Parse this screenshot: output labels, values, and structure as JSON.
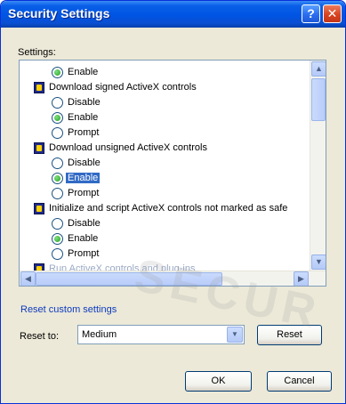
{
  "window": {
    "title": "Security Settings",
    "help_button": "?",
    "close_button": "✕"
  },
  "settings_label": "Settings:",
  "items": [
    {
      "kind": "radio",
      "label": "Enable",
      "checked": true,
      "selected": false
    },
    {
      "kind": "group",
      "label": "Download signed ActiveX controls"
    },
    {
      "kind": "radio",
      "label": "Disable",
      "checked": false,
      "selected": false
    },
    {
      "kind": "radio",
      "label": "Enable",
      "checked": true,
      "selected": false
    },
    {
      "kind": "radio",
      "label": "Prompt",
      "checked": false,
      "selected": false
    },
    {
      "kind": "group",
      "label": "Download unsigned ActiveX controls"
    },
    {
      "kind": "radio",
      "label": "Disable",
      "checked": false,
      "selected": false
    },
    {
      "kind": "radio",
      "label": "Enable",
      "checked": true,
      "selected": true
    },
    {
      "kind": "radio",
      "label": "Prompt",
      "checked": false,
      "selected": false
    },
    {
      "kind": "group",
      "label": "Initialize and script ActiveX controls not marked as safe"
    },
    {
      "kind": "radio",
      "label": "Disable",
      "checked": false,
      "selected": false
    },
    {
      "kind": "radio",
      "label": "Enable",
      "checked": true,
      "selected": false
    },
    {
      "kind": "radio",
      "label": "Prompt",
      "checked": false,
      "selected": false
    },
    {
      "kind": "group",
      "label": "Run ActiveX controls and plug-ins"
    }
  ],
  "reset": {
    "link": "Reset custom settings",
    "label": "Reset to:",
    "value": "Medium",
    "button": "Reset"
  },
  "buttons": {
    "ok": "OK",
    "cancel": "Cancel"
  },
  "watermark": "SECUR",
  "colors": {
    "title_bar": "#0054e3",
    "close": "#d9431f",
    "selection": "#316ac5",
    "link": "#0d3bbd"
  }
}
